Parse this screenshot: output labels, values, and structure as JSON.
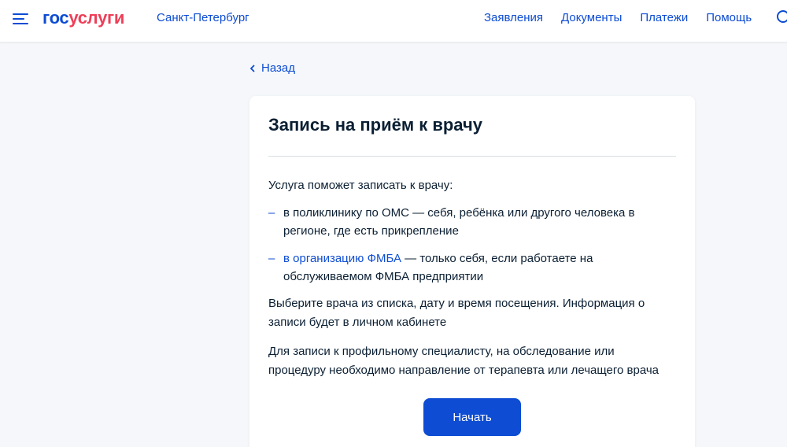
{
  "header": {
    "logo_gos": "гос",
    "logo_uslugi": "услуги",
    "region": "Санкт-Петербург",
    "nav": [
      "Заявления",
      "Документы",
      "Платежи",
      "Помощь"
    ],
    "accent_color": "#0d4cd3",
    "brand_red": "#ee3f58"
  },
  "back_label": "Назад",
  "card": {
    "title": "Запись на приём к врачу",
    "intro": "Услуга поможет записать к врачу:",
    "items": [
      {
        "link": "",
        "text": "в поликлинику по ОМС — себя, ребёнка или другого человека в регионе, где есть прикрепление"
      },
      {
        "link": "в организацию ФМБА",
        "text": " — только себя, если работаете на обслуживаемом ФМБА предприятии"
      }
    ],
    "paragraph1": "Выберите врача из списка, дату и время посещения. Информация о записи будет в личном кабинете",
    "paragraph2": "Для записи к профильному специалисту, на обследование или процедуру необходимо направление от терапевта или лечащего врача",
    "start_button": "Начать"
  }
}
